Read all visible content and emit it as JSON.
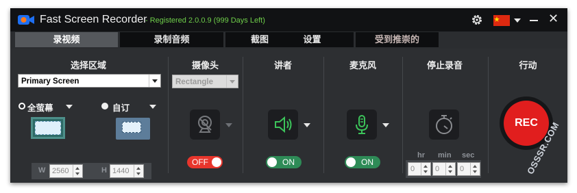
{
  "app": {
    "title": "Fast Screen Recorder",
    "registration": "- Registered 2.0.0.9 (999 Days Left)",
    "flag": "china-flag",
    "colors": {
      "accent_green": "#6fce4a",
      "rec_red": "#e11e1e",
      "toggle_on": "#2e8b57",
      "toggle_off": "#e8352c"
    }
  },
  "tabs": [
    {
      "label": "录视频",
      "active": true
    },
    {
      "label": "录制音频",
      "active": false
    },
    {
      "label": "截图",
      "active": false
    },
    {
      "label": "设置",
      "active": false
    },
    {
      "label": "受到推崇的",
      "active": false
    }
  ],
  "area": {
    "header": "选择区域",
    "screen_select": "Primary Screen",
    "fullscreen_label": "全萤幕",
    "custom_label": "自订",
    "width_label": "W",
    "width_value": "2560",
    "height_label": "H",
    "height_value": "1440"
  },
  "webcam": {
    "header": "摄像头",
    "shape_select": "Rectangle",
    "toggle": {
      "label": "OFF",
      "on": false
    }
  },
  "speaker": {
    "header": "讲者",
    "toggle": {
      "label": "ON",
      "on": true
    }
  },
  "microphone": {
    "header": "麦克风",
    "toggle": {
      "label": "ON",
      "on": true
    }
  },
  "stop_recording": {
    "header": "停止录音",
    "hr_label": "hr",
    "min_label": "min",
    "sec_label": "sec",
    "hr_value": "0",
    "min_value": "0",
    "sec_value": "0"
  },
  "action": {
    "header": "行动",
    "rec_label": "REC"
  },
  "watermark": "OSSSR.COM"
}
